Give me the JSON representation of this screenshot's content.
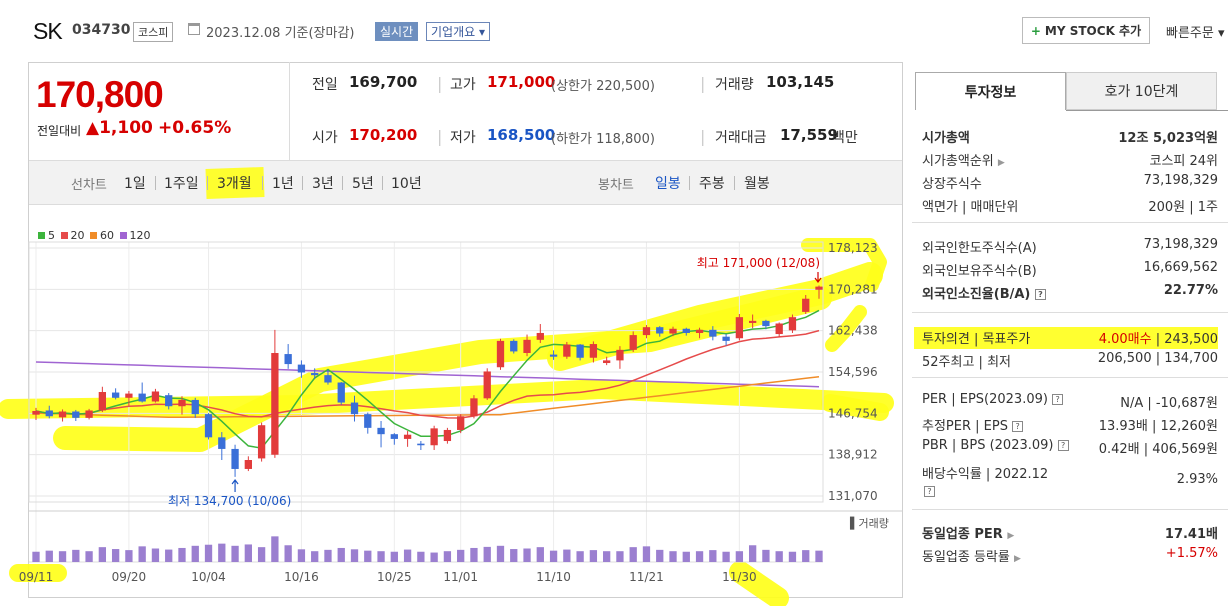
{
  "header": {
    "logo": "SK",
    "code": "034730",
    "market": "코스피",
    "date": "2023.12.08 기준(장마감)",
    "realtime": "실시간",
    "overview": "기업개요 ▾",
    "mystock": "MY STOCK 추가",
    "fast_order": "빠른주문 ▾"
  },
  "price": {
    "current": "170,800",
    "change_label": "전일대비",
    "change": "▲1,100",
    "change_pct": "+0.65%"
  },
  "quote": {
    "prev_label": "전일",
    "prev": "169,700",
    "high_label": "고가",
    "high": "171,000",
    "upper_limit": "(상한가 220,500)",
    "volume_label": "거래량",
    "volume": "103,145",
    "open_label": "시가",
    "open": "170,200",
    "low_label": "저가",
    "low": "168,500",
    "lower_limit": "(하한가 118,800)",
    "amount_label": "거래대금",
    "amount": "17,559",
    "amount_unit": "백만"
  },
  "toolbar": {
    "line_label": "선차트",
    "periods": [
      "1일",
      "1주일",
      "3개월",
      "1년",
      "3년",
      "5년",
      "10년"
    ],
    "selected_period": "3개월",
    "candle_label": "봉차트",
    "candles": [
      "일봉",
      "주봉",
      "월봉"
    ],
    "selected_candle": "일봉"
  },
  "info": {
    "tab_invest": "투자정보",
    "tab_orderbook": "호가 10단계",
    "rows": [
      {
        "label": "시가총액",
        "value": "12조 5,023억원"
      },
      {
        "label": "시가총액순위",
        "value": "코스피 24위"
      },
      {
        "label": "상장주식수",
        "value": "73,198,329"
      },
      {
        "label": "액면가 | 매매단위",
        "value": "200원 | 1주"
      },
      {
        "label": "외국인한도주식수(A)",
        "value": "73,198,329"
      },
      {
        "label": "외국인보유주식수(B)",
        "value": "16,669,562"
      },
      {
        "label": "외국인소진율(B/A)",
        "value": "22.77%"
      },
      {
        "label": "투자의견 | 목표주가",
        "value_a": "4.00매수",
        "value_b": "243,500"
      },
      {
        "label": "52주최고 | 최저",
        "value": "206,500 | 134,700"
      },
      {
        "label": "PER | EPS(2023.09)",
        "value": "N/A | -10,687원"
      },
      {
        "label": "추정PER | EPS",
        "value": "13.93배 | 12,260원"
      },
      {
        "label": "PBR | BPS (2023.09)",
        "value": "0.42배 | 406,569원"
      },
      {
        "label": "배당수익률 | 2022.12",
        "value": "2.93%"
      },
      {
        "label": "동일업종 PER",
        "value": "17.41배"
      },
      {
        "label": "동일업종 등락률",
        "value": "+1.57%"
      }
    ]
  },
  "chart_data": {
    "type": "candlestick",
    "legend": [
      {
        "name": "5",
        "color": "#3cb43c"
      },
      {
        "name": "20",
        "color": "#e64b4b"
      },
      {
        "name": "60",
        "color": "#f08c28"
      },
      {
        "name": "120",
        "color": "#a064d2"
      }
    ],
    "yticks": [
      178123,
      170281,
      162438,
      154596,
      146754,
      138912,
      131070
    ],
    "ylim": [
      131070,
      178123
    ],
    "xticks": [
      "09/11",
      "09/20",
      "10/04",
      "10/16",
      "10/25",
      "11/01",
      "11/10",
      "11/21",
      "11/30"
    ],
    "high_annotation": "최고 171,000 (12/08)",
    "low_annotation": "최저 134,700 (10/06)",
    "volume_label": "거래량",
    "candles": [
      {
        "d": "09/11",
        "o": 146500,
        "h": 147800,
        "l": 145500,
        "c": 147200
      },
      {
        "d": "09/12",
        "o": 147300,
        "h": 148200,
        "l": 145800,
        "c": 146200
      },
      {
        "d": "09/13",
        "o": 146000,
        "h": 147500,
        "l": 145200,
        "c": 147100
      },
      {
        "d": "09/14",
        "o": 147100,
        "h": 147400,
        "l": 145300,
        "c": 145900
      },
      {
        "d": "09/15",
        "o": 145900,
        "h": 147600,
        "l": 145600,
        "c": 147300
      },
      {
        "d": "09/18",
        "o": 147300,
        "h": 151800,
        "l": 147000,
        "c": 150800
      },
      {
        "d": "09/19",
        "o": 150700,
        "h": 151500,
        "l": 149400,
        "c": 149700
      },
      {
        "d": "09/20",
        "o": 149700,
        "h": 151000,
        "l": 148200,
        "c": 150500
      },
      {
        "d": "09/21",
        "o": 150500,
        "h": 152600,
        "l": 148800,
        "c": 149000
      },
      {
        "d": "09/22",
        "o": 149000,
        "h": 151400,
        "l": 148800,
        "c": 150900
      },
      {
        "d": "09/25",
        "o": 150200,
        "h": 150600,
        "l": 147500,
        "c": 148100
      },
      {
        "d": "09/26",
        "o": 148100,
        "h": 150000,
        "l": 146500,
        "c": 149300
      },
      {
        "d": "09/27",
        "o": 149300,
        "h": 149700,
        "l": 145900,
        "c": 146600
      },
      {
        "d": "10/04",
        "o": 146600,
        "h": 146800,
        "l": 141800,
        "c": 142200
      },
      {
        "d": "10/05",
        "o": 142200,
        "h": 143200,
        "l": 137900,
        "c": 140000
      },
      {
        "d": "10/06",
        "o": 140000,
        "h": 140800,
        "l": 134700,
        "c": 136200
      },
      {
        "d": "10/10",
        "o": 136200,
        "h": 138600,
        "l": 135800,
        "c": 137900
      },
      {
        "d": "10/11",
        "o": 138200,
        "h": 145000,
        "l": 137600,
        "c": 144500
      },
      {
        "d": "10/12",
        "o": 138900,
        "h": 162600,
        "l": 138300,
        "c": 158200
      },
      {
        "d": "10/13",
        "o": 158000,
        "h": 159900,
        "l": 155200,
        "c": 156100
      },
      {
        "d": "10/16",
        "o": 156000,
        "h": 156800,
        "l": 153500,
        "c": 154500
      },
      {
        "d": "10/17",
        "o": 154400,
        "h": 155300,
        "l": 153300,
        "c": 154000
      },
      {
        "d": "10/18",
        "o": 154000,
        "h": 155100,
        "l": 152200,
        "c": 152600
      },
      {
        "d": "10/19",
        "o": 152600,
        "h": 152700,
        "l": 148400,
        "c": 148800
      },
      {
        "d": "10/20",
        "o": 148800,
        "h": 150100,
        "l": 145200,
        "c": 146600
      },
      {
        "d": "10/23",
        "o": 146600,
        "h": 146900,
        "l": 142900,
        "c": 144000
      },
      {
        "d": "10/24",
        "o": 144000,
        "h": 145300,
        "l": 140300,
        "c": 142800
      },
      {
        "d": "10/25",
        "o": 142800,
        "h": 143000,
        "l": 140800,
        "c": 141900
      },
      {
        "d": "10/26",
        "o": 141900,
        "h": 143400,
        "l": 140400,
        "c": 142700
      },
      {
        "d": "10/27",
        "o": 141000,
        "h": 141500,
        "l": 139800,
        "c": 140700
      },
      {
        "d": "10/30",
        "o": 140700,
        "h": 144400,
        "l": 139800,
        "c": 143900
      },
      {
        "d": "10/31",
        "o": 141500,
        "h": 144000,
        "l": 141000,
        "c": 143600
      },
      {
        "d": "11/01",
        "o": 143600,
        "h": 146600,
        "l": 143000,
        "c": 146200
      },
      {
        "d": "11/02",
        "o": 146200,
        "h": 150200,
        "l": 145800,
        "c": 149600
      },
      {
        "d": "11/03",
        "o": 149600,
        "h": 155300,
        "l": 149300,
        "c": 154700
      },
      {
        "d": "11/06",
        "o": 155500,
        "h": 160900,
        "l": 155000,
        "c": 160500
      },
      {
        "d": "11/07",
        "o": 160500,
        "h": 160800,
        "l": 158100,
        "c": 158500
      },
      {
        "d": "11/08",
        "o": 158200,
        "h": 161700,
        "l": 157600,
        "c": 160700
      },
      {
        "d": "11/09",
        "o": 160700,
        "h": 163700,
        "l": 160100,
        "c": 162000
      },
      {
        "d": "11/10",
        "o": 157900,
        "h": 158700,
        "l": 156900,
        "c": 157500
      },
      {
        "d": "11/13",
        "o": 157500,
        "h": 160300,
        "l": 157100,
        "c": 159800
      },
      {
        "d": "11/14",
        "o": 159800,
        "h": 159900,
        "l": 156800,
        "c": 157300
      },
      {
        "d": "11/15",
        "o": 157300,
        "h": 160400,
        "l": 156400,
        "c": 159900
      },
      {
        "d": "11/16",
        "o": 156300,
        "h": 157500,
        "l": 155900,
        "c": 156800
      },
      {
        "d": "11/17",
        "o": 156800,
        "h": 159500,
        "l": 155200,
        "c": 158800
      },
      {
        "d": "11/20",
        "o": 158800,
        "h": 162300,
        "l": 158400,
        "c": 161600
      },
      {
        "d": "11/21",
        "o": 161600,
        "h": 163500,
        "l": 161000,
        "c": 163100
      },
      {
        "d": "11/22",
        "o": 163100,
        "h": 163300,
        "l": 161300,
        "c": 161900
      },
      {
        "d": "11/23",
        "o": 161900,
        "h": 163200,
        "l": 161400,
        "c": 162800
      },
      {
        "d": "11/24",
        "o": 162800,
        "h": 163000,
        "l": 161500,
        "c": 162000
      },
      {
        "d": "11/27",
        "o": 162000,
        "h": 163000,
        "l": 161000,
        "c": 162600
      },
      {
        "d": "11/28",
        "o": 162600,
        "h": 163300,
        "l": 160600,
        "c": 161300
      },
      {
        "d": "11/29",
        "o": 161300,
        "h": 161800,
        "l": 159600,
        "c": 160500
      },
      {
        "d": "11/30",
        "o": 161000,
        "h": 165600,
        "l": 160600,
        "c": 165000
      },
      {
        "d": "12/01",
        "o": 163900,
        "h": 165500,
        "l": 162900,
        "c": 164300
      },
      {
        "d": "12/04",
        "o": 164300,
        "h": 164500,
        "l": 162700,
        "c": 163300
      },
      {
        "d": "12/05",
        "o": 161800,
        "h": 164000,
        "l": 161200,
        "c": 163800
      },
      {
        "d": "12/06",
        "o": 162500,
        "h": 165500,
        "l": 162000,
        "c": 165000
      },
      {
        "d": "12/07",
        "o": 166000,
        "h": 169200,
        "l": 165600,
        "c": 168500
      },
      {
        "d": "12/08",
        "o": 170200,
        "h": 171000,
        "l": 168500,
        "c": 170800
      }
    ],
    "volumes": [
      38,
      42,
      40,
      45,
      40,
      55,
      48,
      44,
      58,
      50,
      46,
      52,
      60,
      64,
      68,
      60,
      65,
      55,
      95,
      62,
      47,
      40,
      45,
      52,
      47,
      42,
      40,
      38,
      46,
      38,
      35,
      40,
      45,
      52,
      56,
      60,
      48,
      50,
      55,
      42,
      46,
      40,
      44,
      40,
      40,
      55,
      58,
      45,
      40,
      38,
      40,
      44,
      38,
      40,
      62,
      45,
      40,
      38,
      44,
      42
    ]
  }
}
